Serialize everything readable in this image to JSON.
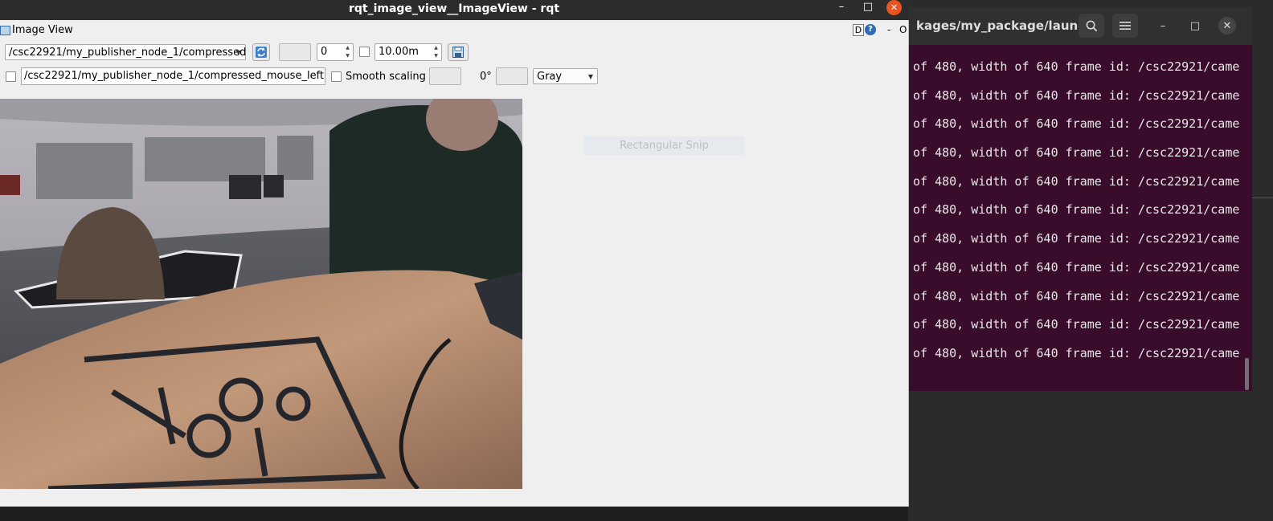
{
  "rqt_window": {
    "title": "rqt_image_view__ImageView - rqt",
    "minimize_glyph": "–",
    "maximize_glyph": "□",
    "close_glyph": "✕"
  },
  "panel": {
    "title": "Image View",
    "d_label": "D",
    "help_label": "?",
    "dash_label": "-",
    "o_label": "O"
  },
  "toolbar": {
    "topic": "/csc22921/my_publisher_node_1/compressed",
    "spin_value": "0",
    "duration_value": "10.00m"
  },
  "toolbar2": {
    "mouse_topic": "/csc22921/my_publisher_node_1/compressed_mouse_left",
    "smooth_scaling_label": "Smooth scaling",
    "rotation_label": "0°",
    "color_scheme": "Gray"
  },
  "snip": {
    "label": "Rectangular Snip"
  },
  "terminal": {
    "title": "kages/my_package/launc...",
    "lines": [
      "of 480, width of 640 frame id: /csc22921/came",
      "of 480, width of 640 frame id: /csc22921/came",
      "of 480, width of 640 frame id: /csc22921/came",
      "of 480, width of 640 frame id: /csc22921/came",
      "of 480, width of 640 frame id: /csc22921/came",
      "of 480, width of 640 frame id: /csc22921/came",
      "of 480, width of 640 frame id: /csc22921/came",
      "of 480, width of 640 frame id: /csc22921/came",
      "of 480, width of 640 frame id: /csc22921/came",
      "of 480, width of 640 frame id: /csc22921/came",
      "of 480, width of 640 frame id: /csc22921/came"
    ]
  },
  "colors": {
    "terminal_bg": "#380c2a",
    "ubuntu_orange": "#e95420",
    "rqt_bg": "#efefef"
  }
}
